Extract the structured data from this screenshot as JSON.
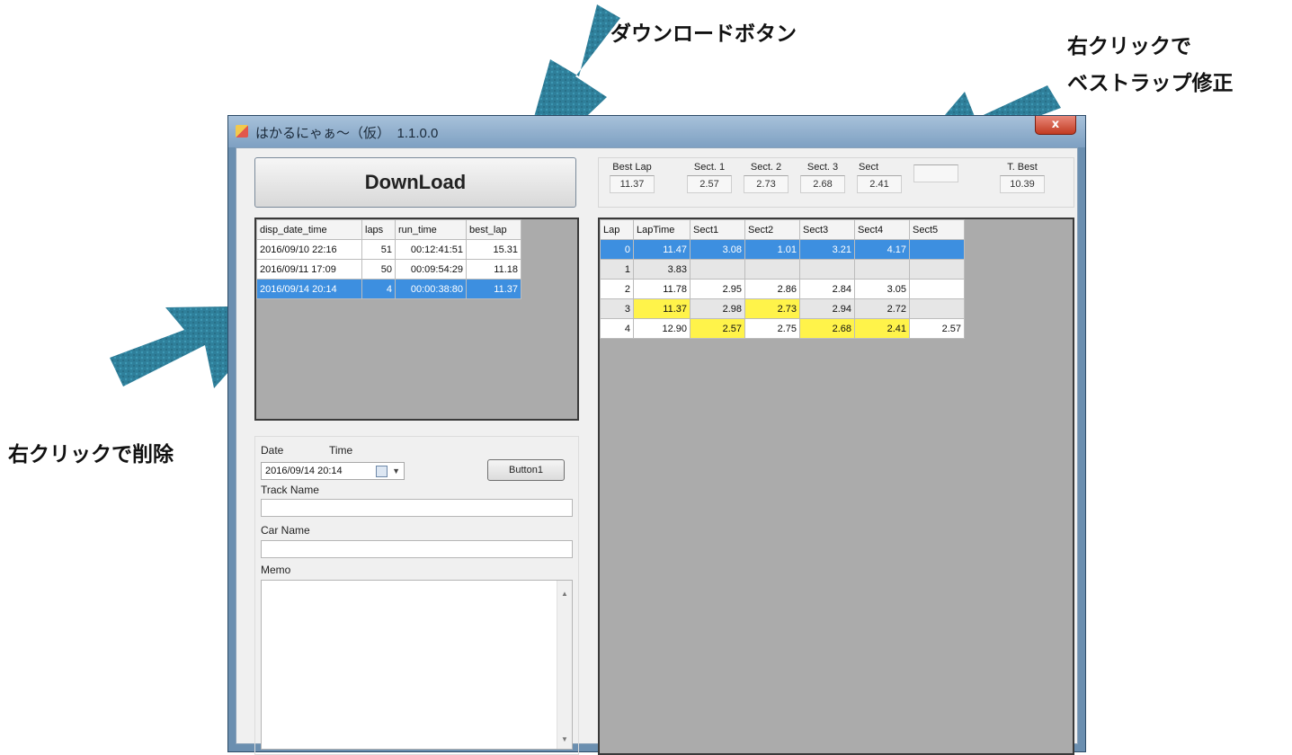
{
  "annotations": {
    "download": "ダウンロードボタン",
    "best_lap_line1": "右クリックで",
    "best_lap_line2": "ベストラップ修正",
    "delete": "右クリックで削除"
  },
  "window": {
    "title": "はかるにゃぁ～（仮）　1.1.0.0",
    "close_label": "x"
  },
  "download_button": "DownLoad",
  "summary": [
    {
      "label": "Best Lap",
      "value": "11.37"
    },
    {
      "label": "Sect. 1",
      "value": "2.57"
    },
    {
      "label": "Sect. 2",
      "value": "2.73"
    },
    {
      "label": "Sect. 3",
      "value": "2.68"
    },
    {
      "label": "Sect",
      "value": "2.41"
    },
    {
      "label": "",
      "value": ""
    },
    {
      "label": "T. Best",
      "value": "10.39"
    }
  ],
  "sessions": {
    "headers": [
      "disp_date_time",
      "laps",
      "run_time",
      "best_lap"
    ],
    "rows": [
      [
        "2016/09/10 22:16",
        "51",
        "00:12:41:51",
        "15.31"
      ],
      [
        "2016/09/11 17:09",
        "50",
        "00:09:54:29",
        "11.18"
      ],
      [
        "2016/09/14 20:14",
        "4",
        "00:00:38:80",
        "11.37"
      ]
    ],
    "selected_index": 2
  },
  "detail": {
    "date_label": "Date",
    "time_label": "Time",
    "datetime_value": "2016/09/14 20:14",
    "button1": "Button1",
    "track_label": "Track Name",
    "car_label": "Car Name",
    "memo_label": "Memo",
    "scroll_up": "▲",
    "scroll_down": "▼"
  },
  "laps": {
    "headers": [
      "Lap",
      "LapTime",
      "Sect1",
      "Sect2",
      "Sect3",
      "Sect4",
      "Sect5"
    ],
    "rows": [
      [
        "0",
        "11.47",
        "3.08",
        "1.01",
        "3.21",
        "4.17",
        ""
      ],
      [
        "1",
        "3.83",
        "",
        "",
        "",
        "",
        ""
      ],
      [
        "2",
        "11.78",
        "2.95",
        "2.86",
        "2.84",
        "3.05",
        ""
      ],
      [
        "3",
        "11.37",
        "2.98",
        "2.73",
        "2.94",
        "2.72",
        ""
      ],
      [
        "4",
        "12.90",
        "2.57",
        "2.75",
        "2.68",
        "2.41",
        "2.57"
      ]
    ],
    "selected_index": 0,
    "highlight_color": "#fff34a",
    "select_color": "#3d8fe0"
  }
}
